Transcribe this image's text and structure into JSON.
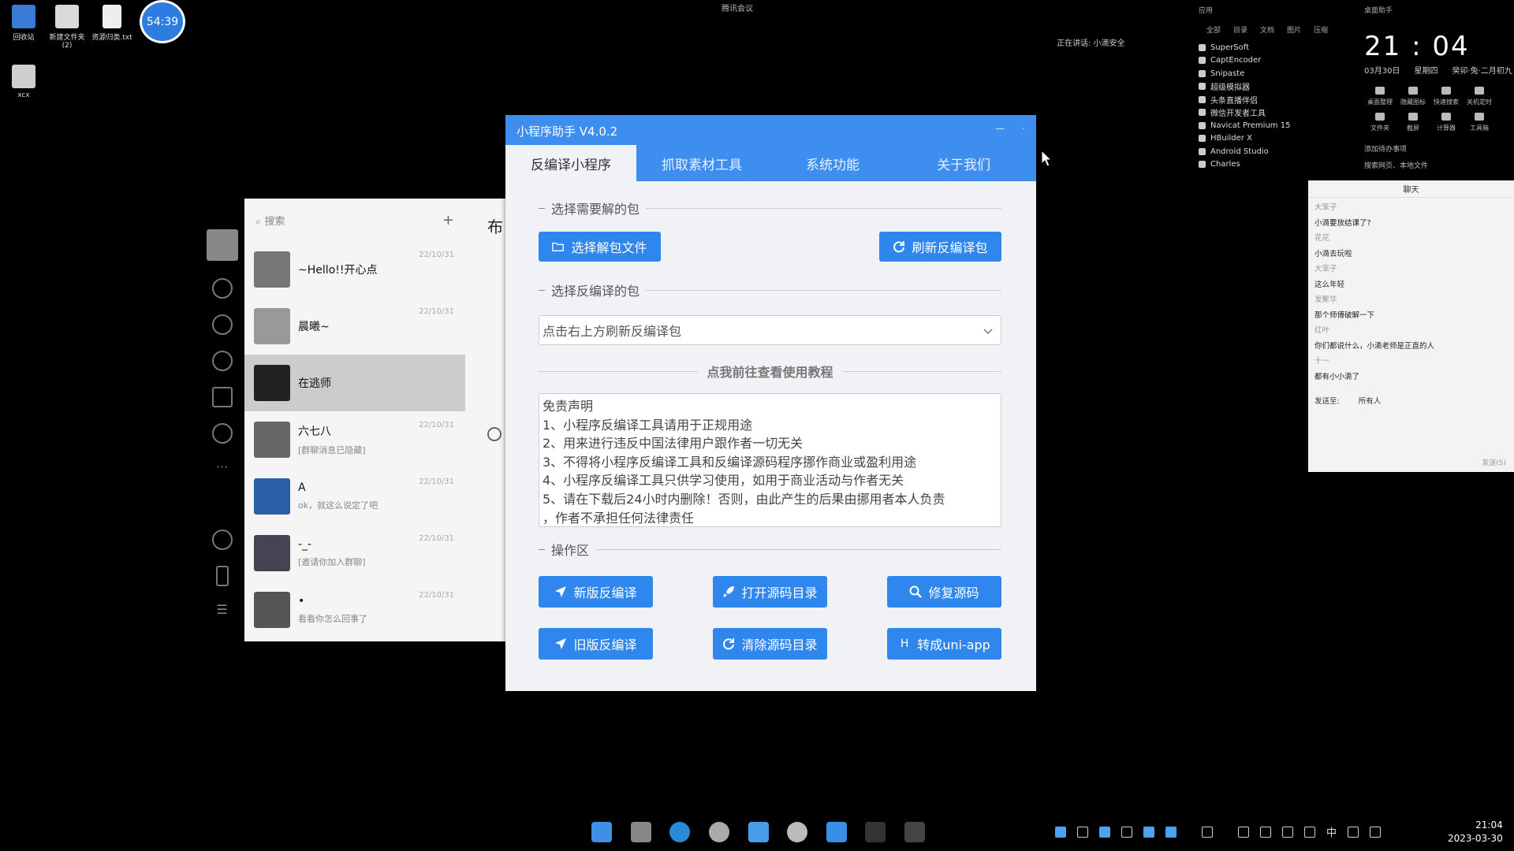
{
  "desktop": {
    "icons": [
      {
        "label": "回收站"
      },
      {
        "label": "新建文件夹 (2)"
      },
      {
        "label": "资源归类.txt"
      },
      {
        "label": "xcx"
      }
    ],
    "timer": "54:39"
  },
  "top_bar": {
    "meeting": "腾讯会议",
    "speaking": "正在讲话: 小滴安全"
  },
  "apps_panel": {
    "title": "应用",
    "tabs": [
      "全部",
      "目录",
      "文档",
      "图片",
      "压缩"
    ],
    "items": [
      "SuperSoft",
      "CaptEncoder",
      "Snipaste",
      "超级模拟器",
      "头条直播伴侣",
      "微信开发者工具",
      "Navicat Premium 15",
      "HBuilder X",
      "Android Studio",
      "Charles"
    ]
  },
  "clock_panel": {
    "title": "桌面助手",
    "time": "21 : 04",
    "date": "03月30日",
    "weekday": "星期四",
    "lunar": "癸卯·兔·二月初九",
    "tools": [
      "桌面整理",
      "隐藏图标",
      "快速搜索",
      "关机定时",
      "文件夹",
      "截屏",
      "计算器",
      "工具箱"
    ],
    "todo": "添加待办事项",
    "search": "搜索网页、本地文件"
  },
  "wechat": {
    "search_placeholder": "搜索",
    "chat_title": "布",
    "contacts": [
      {
        "name": "~Hello!!开心点",
        "time": "22/10/31",
        "msg": ""
      },
      {
        "name": "晨曦~",
        "time": "22/10/31",
        "msg": ""
      },
      {
        "name": "在逃师",
        "time": "",
        "msg": ""
      },
      {
        "name": "六七八",
        "time": "22/10/31",
        "msg": "[群聊消息已隐藏]"
      },
      {
        "name": "A",
        "time": "22/10/31",
        "msg": "ok，就这么说定了吧"
      },
      {
        "name": "-_-",
        "time": "22/10/31",
        "msg": "[邀请你加入群聊]"
      },
      {
        "name": "•",
        "time": "22/10/31",
        "msg": "看看你怎么回事了"
      }
    ]
  },
  "app": {
    "title": "小程序助手 V4.0.2",
    "tabs": [
      "反编译小程序",
      "抓取素材工具",
      "系统功能",
      "关于我们"
    ],
    "section1": "选择需要解的包",
    "btn_select_file": "选择解包文件",
    "btn_refresh": "刷新反编译包",
    "section2": "选择反编译的包",
    "select_placeholder": "点击右上方刷新反编译包",
    "tutorial": "点我前往查看使用教程",
    "disclaimer": [
      "免责声明",
      "1、小程序反编译工具请用于正规用途",
      "2、用来进行违反中国法律用户跟作者一切无关",
      "3、不得将小程序反编译工具和反编译源码程序挪作商业或盈利用途",
      "4、小程序反编译工具只供学习使用，如用于商业活动与作者无关",
      "5、请在下载后24小时内删除！否则，由此产生的后果由挪用者本人负责",
      "，作者不承担任何法律责任"
    ],
    "section3": "操作区",
    "ops": [
      [
        "新版反编译",
        "打开源码目录",
        "修复源码"
      ],
      [
        "旧版反编译",
        "清除源码目录",
        "转成uni-app"
      ]
    ]
  },
  "chat_window": {
    "title": "聊天",
    "lines": [
      {
        "user": "大笨子",
        "msg": "小滴要放结课了?"
      },
      {
        "user": "花花",
        "msg": "小滴去玩啦"
      },
      {
        "user": "大笨子",
        "msg": "这么年轻"
      },
      {
        "user": "发聚华",
        "msg": "那个师傅破解一下"
      },
      {
        "user": "红叶",
        "msg": "你们都说什么，小滴老师是正直的人"
      },
      {
        "user": "十一",
        "msg": "都有小小滴了"
      }
    ],
    "send_to_label": "发送至:",
    "send_to_value": "所有人",
    "send_btn": "发送(S)"
  },
  "taskbar": {
    "ime": "中",
    "time": "21:04",
    "date": "2023-03-30"
  }
}
